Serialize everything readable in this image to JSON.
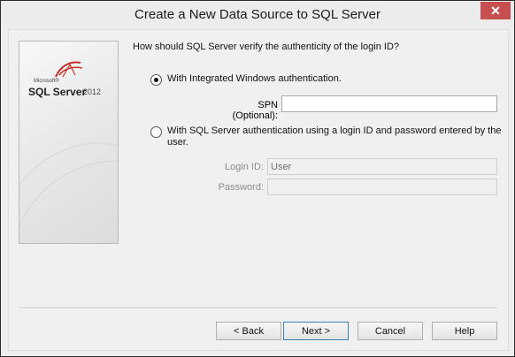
{
  "window": {
    "title": "Create a New Data Source to SQL Server",
    "close_glyph": "✕"
  },
  "side": {
    "ms": "Microsoft®",
    "product": "SQL Server",
    "version": "2012"
  },
  "question": "How should SQL Server verify the authenticity of the login ID?",
  "auth": {
    "integrated_label": "With Integrated Windows authentication.",
    "integrated_selected": true,
    "spn_label": "SPN (Optional):",
    "spn_value": "",
    "sql_label": "With SQL Server authentication using a login ID and password entered by the user.",
    "sql_selected": false,
    "login_label": "Login ID:",
    "login_value": "User",
    "password_label": "Password:",
    "password_value": ""
  },
  "buttons": {
    "back": "< Back",
    "next": "Next >",
    "cancel": "Cancel",
    "help": "Help"
  },
  "colors": {
    "close": "#c74f4f",
    "accent": "#3c7fb1"
  }
}
